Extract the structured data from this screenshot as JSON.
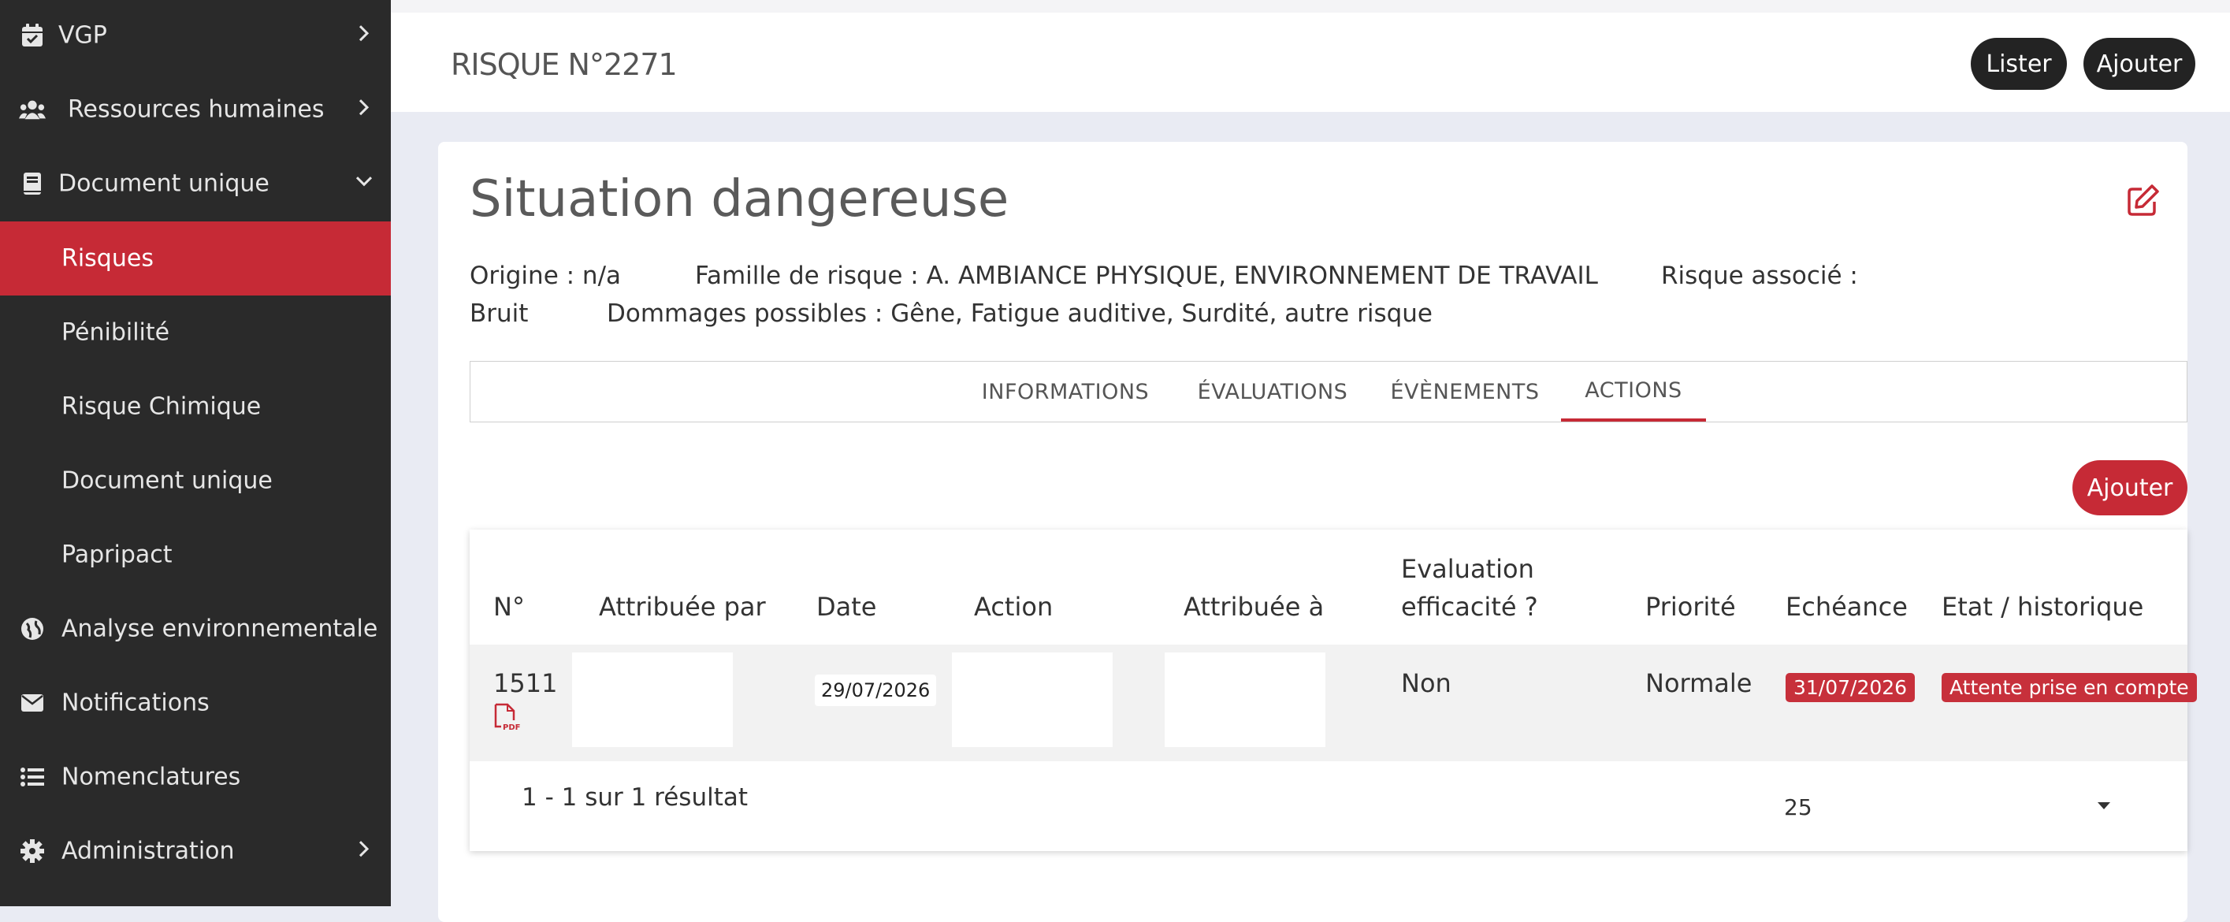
{
  "sidebar": {
    "items": [
      {
        "label": "VGP",
        "icon": "calendar-check-icon",
        "chevron": "right"
      },
      {
        "label": "Ressources humaines",
        "icon": "users-icon",
        "chevron": "right"
      },
      {
        "label": "Document unique",
        "icon": "book-icon",
        "chevron": "down"
      },
      {
        "label": "Risques",
        "active": true
      },
      {
        "label": "Pénibilité"
      },
      {
        "label": "Risque Chimique"
      },
      {
        "label": "Document unique"
      },
      {
        "label": "Papripact"
      },
      {
        "label": "Analyse environnementale",
        "icon": "globe-icon"
      },
      {
        "label": "Notifications",
        "icon": "envelope-icon"
      },
      {
        "label": "Nomenclatures",
        "icon": "list-icon"
      },
      {
        "label": "Administration",
        "icon": "gear-icon",
        "chevron": "right"
      }
    ],
    "active_color": "#c62a36",
    "background": "#2a2a2a"
  },
  "header": {
    "title": "RISQUE N°2271",
    "lister_label": "Lister",
    "ajouter_label": "Ajouter"
  },
  "card": {
    "heading": "Situation dangereuse",
    "edit_icon": "edit-icon",
    "origine": "Origine : n/a",
    "famille": "Famille de risque : A. AMBIANCE PHYSIQUE, ENVIRONNEMENT DE TRAVAIL",
    "risque_associe": "Risque associé :",
    "bruit": "Bruit",
    "dommages": "Dommages possibles : Gêne, Fatigue auditive, Surdité, autre risque"
  },
  "tabs": [
    {
      "label": "INFORMATIONS"
    },
    {
      "label": "ÉVALUATIONS"
    },
    {
      "label": "ÉVÈNEMENTS"
    },
    {
      "label": "ACTIONS",
      "active": true
    }
  ],
  "actions": {
    "add_label": "Ajouter",
    "columns": [
      "N°",
      "Attribuée par",
      "Date",
      "Action",
      "Attribuée à",
      "Evaluation",
      "efficacité ?",
      "Priorité",
      "Echéance",
      "Etat / historique"
    ],
    "row": {
      "number": "1511",
      "date": "29/07/2026",
      "evaluation": "Non",
      "priorite": "Normale",
      "echeance": "31/07/2026",
      "etat": "Attente prise en compte"
    },
    "pager_text": "1 - 1 sur 1 résultat",
    "page_size": "25",
    "accent": "#c7303b"
  }
}
